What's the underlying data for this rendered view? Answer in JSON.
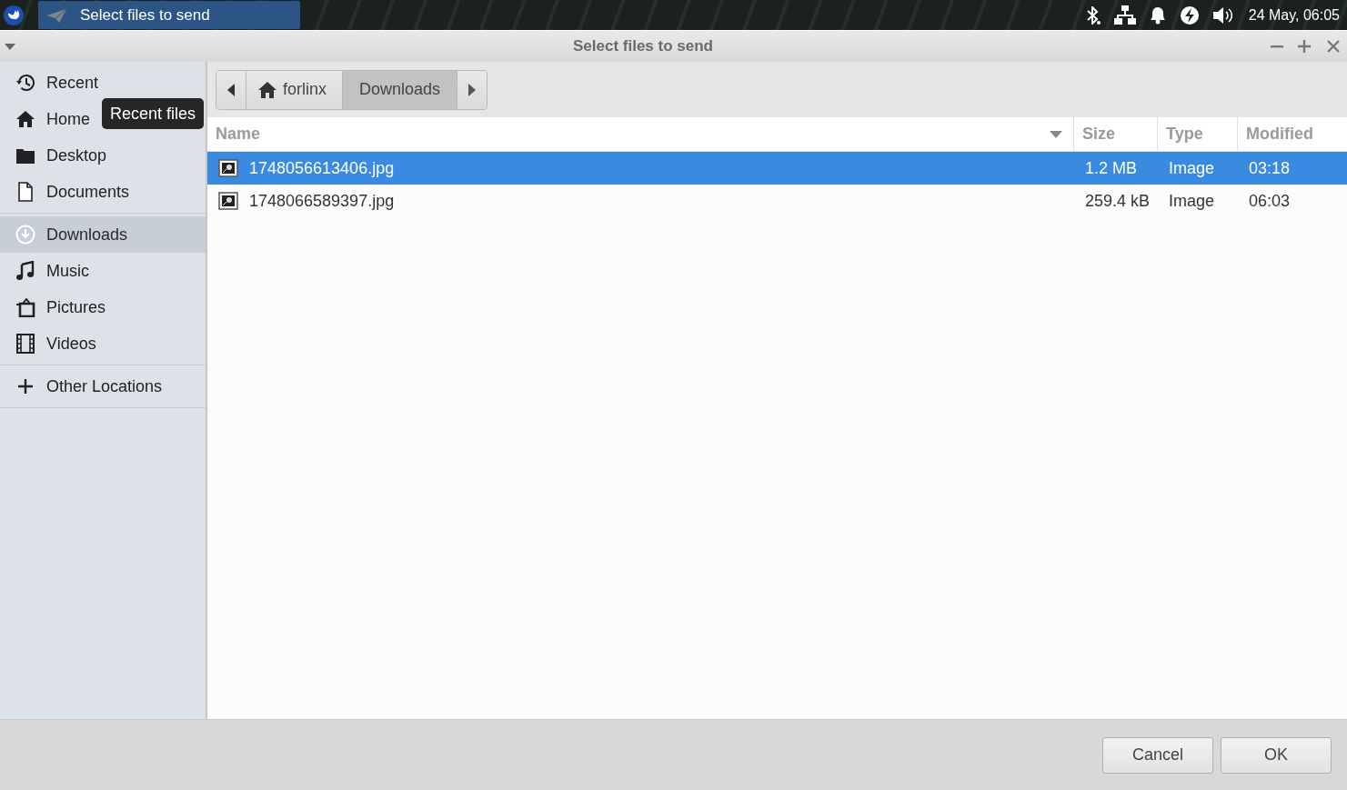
{
  "taskbar": {
    "window_button": {
      "title": "Select files to send",
      "active": true
    },
    "clock": "24 May, 06:05"
  },
  "window": {
    "title": "Select files to send"
  },
  "sidebar": {
    "sections": [
      {
        "items": [
          {
            "label": "Recent",
            "selected": false
          },
          {
            "label": "Home",
            "selected": false
          },
          {
            "label": "Desktop",
            "selected": false
          },
          {
            "label": "Documents",
            "selected": false
          }
        ]
      },
      {
        "items": [
          {
            "label": "Downloads",
            "selected": true
          },
          {
            "label": "Music",
            "selected": false
          },
          {
            "label": "Pictures",
            "selected": false
          },
          {
            "label": "Videos",
            "selected": false
          }
        ]
      },
      {
        "items": [
          {
            "label": "Other Locations",
            "selected": false
          }
        ]
      }
    ],
    "tooltip": "Recent files"
  },
  "pathbar": {
    "segments": [
      {
        "label": "forlinx",
        "selected": false
      },
      {
        "label": "Downloads",
        "selected": true
      }
    ]
  },
  "file_list": {
    "columns": [
      {
        "label": "Name",
        "sorted": true
      },
      {
        "label": "Size",
        "sorted": false
      },
      {
        "label": "Type",
        "sorted": false
      },
      {
        "label": "Modified",
        "sorted": false
      }
    ],
    "rows": [
      {
        "name": "1748056613406.jpg",
        "size": "1.2 MB",
        "type": "Image",
        "modified": "03:18",
        "selected": true
      },
      {
        "name": "1748066589397.jpg",
        "size": "259.4 kB",
        "type": "Image",
        "modified": "06:03",
        "selected": false
      }
    ]
  },
  "buttons": [
    {
      "label": "Cancel"
    },
    {
      "label": "OK"
    }
  ]
}
